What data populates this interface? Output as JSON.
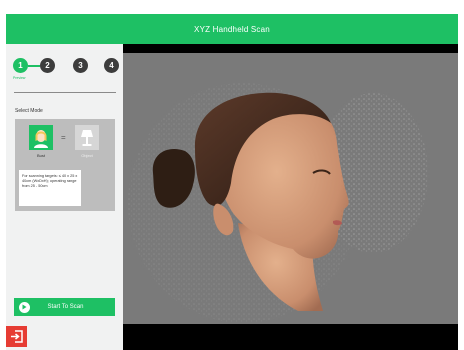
{
  "app": {
    "title": "XYZ Handheld Scan",
    "accent_color": "#1ec064",
    "danger_color": "#e63c33"
  },
  "steps": {
    "items": [
      {
        "number": "1",
        "active": true
      },
      {
        "number": "2",
        "active": false
      },
      {
        "number": "3",
        "active": false
      },
      {
        "number": "4",
        "active": false
      }
    ],
    "active_caption": "Preview"
  },
  "mode": {
    "section_label": "Select Mode",
    "options": [
      {
        "label": "Bust",
        "icon": "head-icon",
        "selected": true
      },
      {
        "label": "Object",
        "icon": "lamp-icon",
        "selected": false
      }
    ],
    "separator": "=",
    "description": "For scanning targets: ≤ 40 x 25 x 40cm (WxDxH); operating range from 25 - 50cm"
  },
  "actions": {
    "start_scan": "Start To Scan",
    "start_scan_icon": "play-icon",
    "exit_icon": "exit-icon"
  },
  "viewport": {
    "content": "3D head scan preview"
  }
}
